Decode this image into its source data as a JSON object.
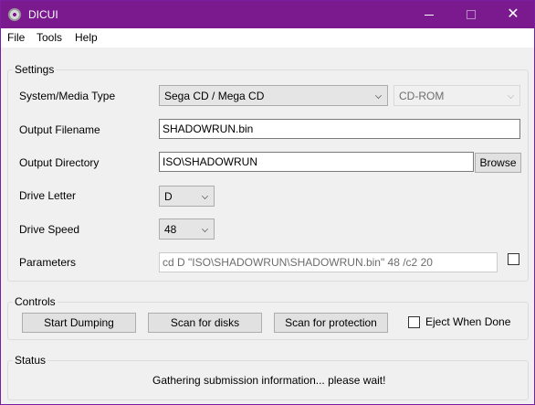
{
  "window": {
    "title": "DICUI",
    "icons": {
      "app": "disc-icon",
      "minimize": "minimize-icon",
      "maximize": "maximize-icon",
      "close": "close-icon"
    },
    "close_glyph": "✕"
  },
  "menu": {
    "file": "File",
    "tools": "Tools",
    "help": "Help"
  },
  "settings": {
    "group_label": "Settings",
    "system_media_type_label": "System/Media Type",
    "system_value": "Sega CD / Mega CD",
    "media_value": "CD-ROM",
    "output_filename_label": "Output Filename",
    "output_filename_value": "SHADOWRUN.bin",
    "output_directory_label": "Output Directory",
    "output_directory_value": "ISO\\SHADOWRUN",
    "browse_label": "Browse",
    "drive_letter_label": "Drive Letter",
    "drive_letter_value": "D",
    "drive_speed_label": "Drive Speed",
    "drive_speed_value": "48",
    "parameters_label": "Parameters",
    "parameters_value": "cd D \"ISO\\SHADOWRUN\\SHADOWRUN.bin\" 48 /c2 20",
    "parameters_checkbox_checked": false
  },
  "controls": {
    "group_label": "Controls",
    "start_dumping": "Start Dumping",
    "scan_for_disks": "Scan for disks",
    "scan_for_protection": "Scan for protection",
    "eject_when_done_label": "Eject When Done",
    "eject_when_done_checked": false
  },
  "status": {
    "group_label": "Status",
    "message": "Gathering submission information... please wait!"
  },
  "colors": {
    "titlebar": "#7a1a8e",
    "background": "#f0f0f0"
  }
}
